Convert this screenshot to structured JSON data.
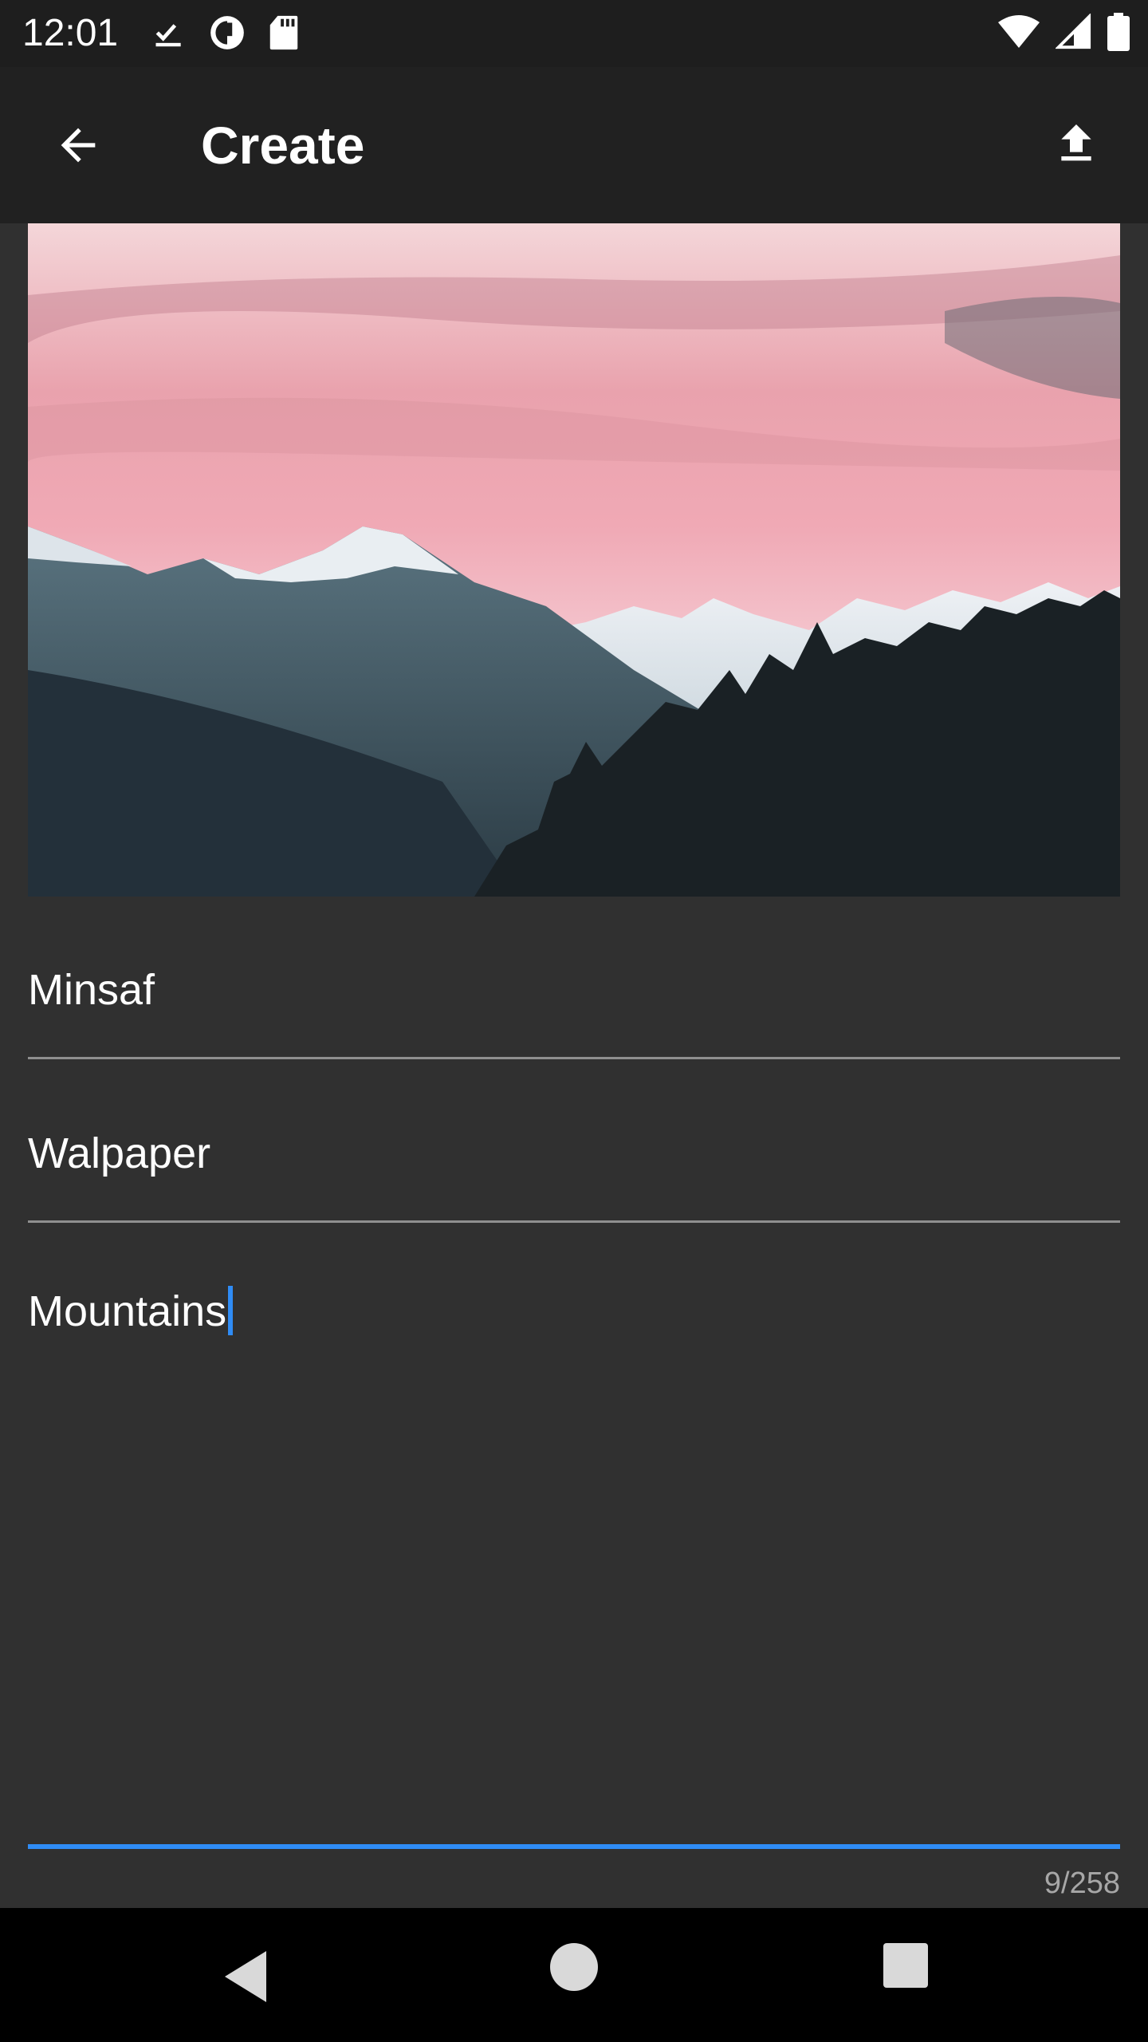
{
  "status": {
    "time": "12:01",
    "left_icons": [
      "check-download-icon",
      "data-saver-icon",
      "sd-card-icon"
    ],
    "right_icons": [
      "wifi-icon",
      "signal-icon",
      "battery-icon"
    ]
  },
  "app_bar": {
    "title": "Create",
    "back_icon": "arrow-back-icon",
    "upload_icon": "upload-icon"
  },
  "image": {
    "subject": "mountains-sunset-photo"
  },
  "form": {
    "creator_value": "Minsaf",
    "category_value": "Walpaper",
    "tags_value": "Mountains",
    "counter": "9/258"
  },
  "colors": {
    "background": "#303030",
    "app_bar": "#212121",
    "accent": "#2f8cf5"
  }
}
